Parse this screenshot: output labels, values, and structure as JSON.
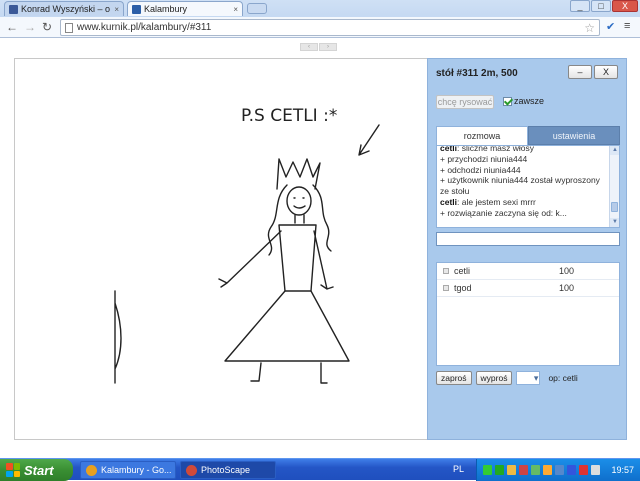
{
  "browser": {
    "tabs": [
      {
        "title": "Konrad Wyszyński – o",
        "favicon_color": "#3b5998"
      },
      {
        "title": "Kalambury",
        "favicon_color": "#2c5fa8"
      }
    ],
    "url": "www.kurnik.pl/kalambury/#311",
    "close_glyph": "×",
    "window_buttons": {
      "minimize": "_",
      "maximize": "□",
      "close": "X"
    }
  },
  "canvas": {
    "text": "P.S  CETLI :*"
  },
  "panel": {
    "table_title": "stół #311   2m, 500",
    "minimize_label": "–",
    "close_label": "X",
    "draw_button": "chcę rysować",
    "always_label": "zawsze",
    "tabs": {
      "chat": "rozmowa",
      "settings": "ustawienia"
    },
    "chat": [
      {
        "user": "cetli",
        "text": ": śliczne masz włosy"
      },
      {
        "user": "",
        "text": "+ przychodzi niunia444"
      },
      {
        "user": "",
        "text": "+ odchodzi niunia444"
      },
      {
        "user": "",
        "text": "+ użytkownik niunia444 został wyproszony"
      },
      {
        "user": "",
        "text": "   ze stołu"
      },
      {
        "user": "cetli",
        "text": ": ale jestem sexi mrrr"
      },
      {
        "user": "",
        "text": "+ rozwiązanie zaczyna się od: k..."
      }
    ],
    "chat_input": {
      "value": "",
      "placeholder": ""
    },
    "players": [
      {
        "name": "cetli",
        "score": "100"
      },
      {
        "name": "tgod",
        "score": "100"
      }
    ],
    "invite_button": "zaproś",
    "kick_button": "wyproś",
    "op_label": "op: cetli"
  },
  "taskbar": {
    "start_label": "Start",
    "tasks": [
      {
        "label": "Kalambury - Go...",
        "icon_color": "#e8a020"
      },
      {
        "label": "PhotoScape",
        "icon_color": "#d04a3a"
      }
    ],
    "language": "PL",
    "clock": "19:57"
  }
}
